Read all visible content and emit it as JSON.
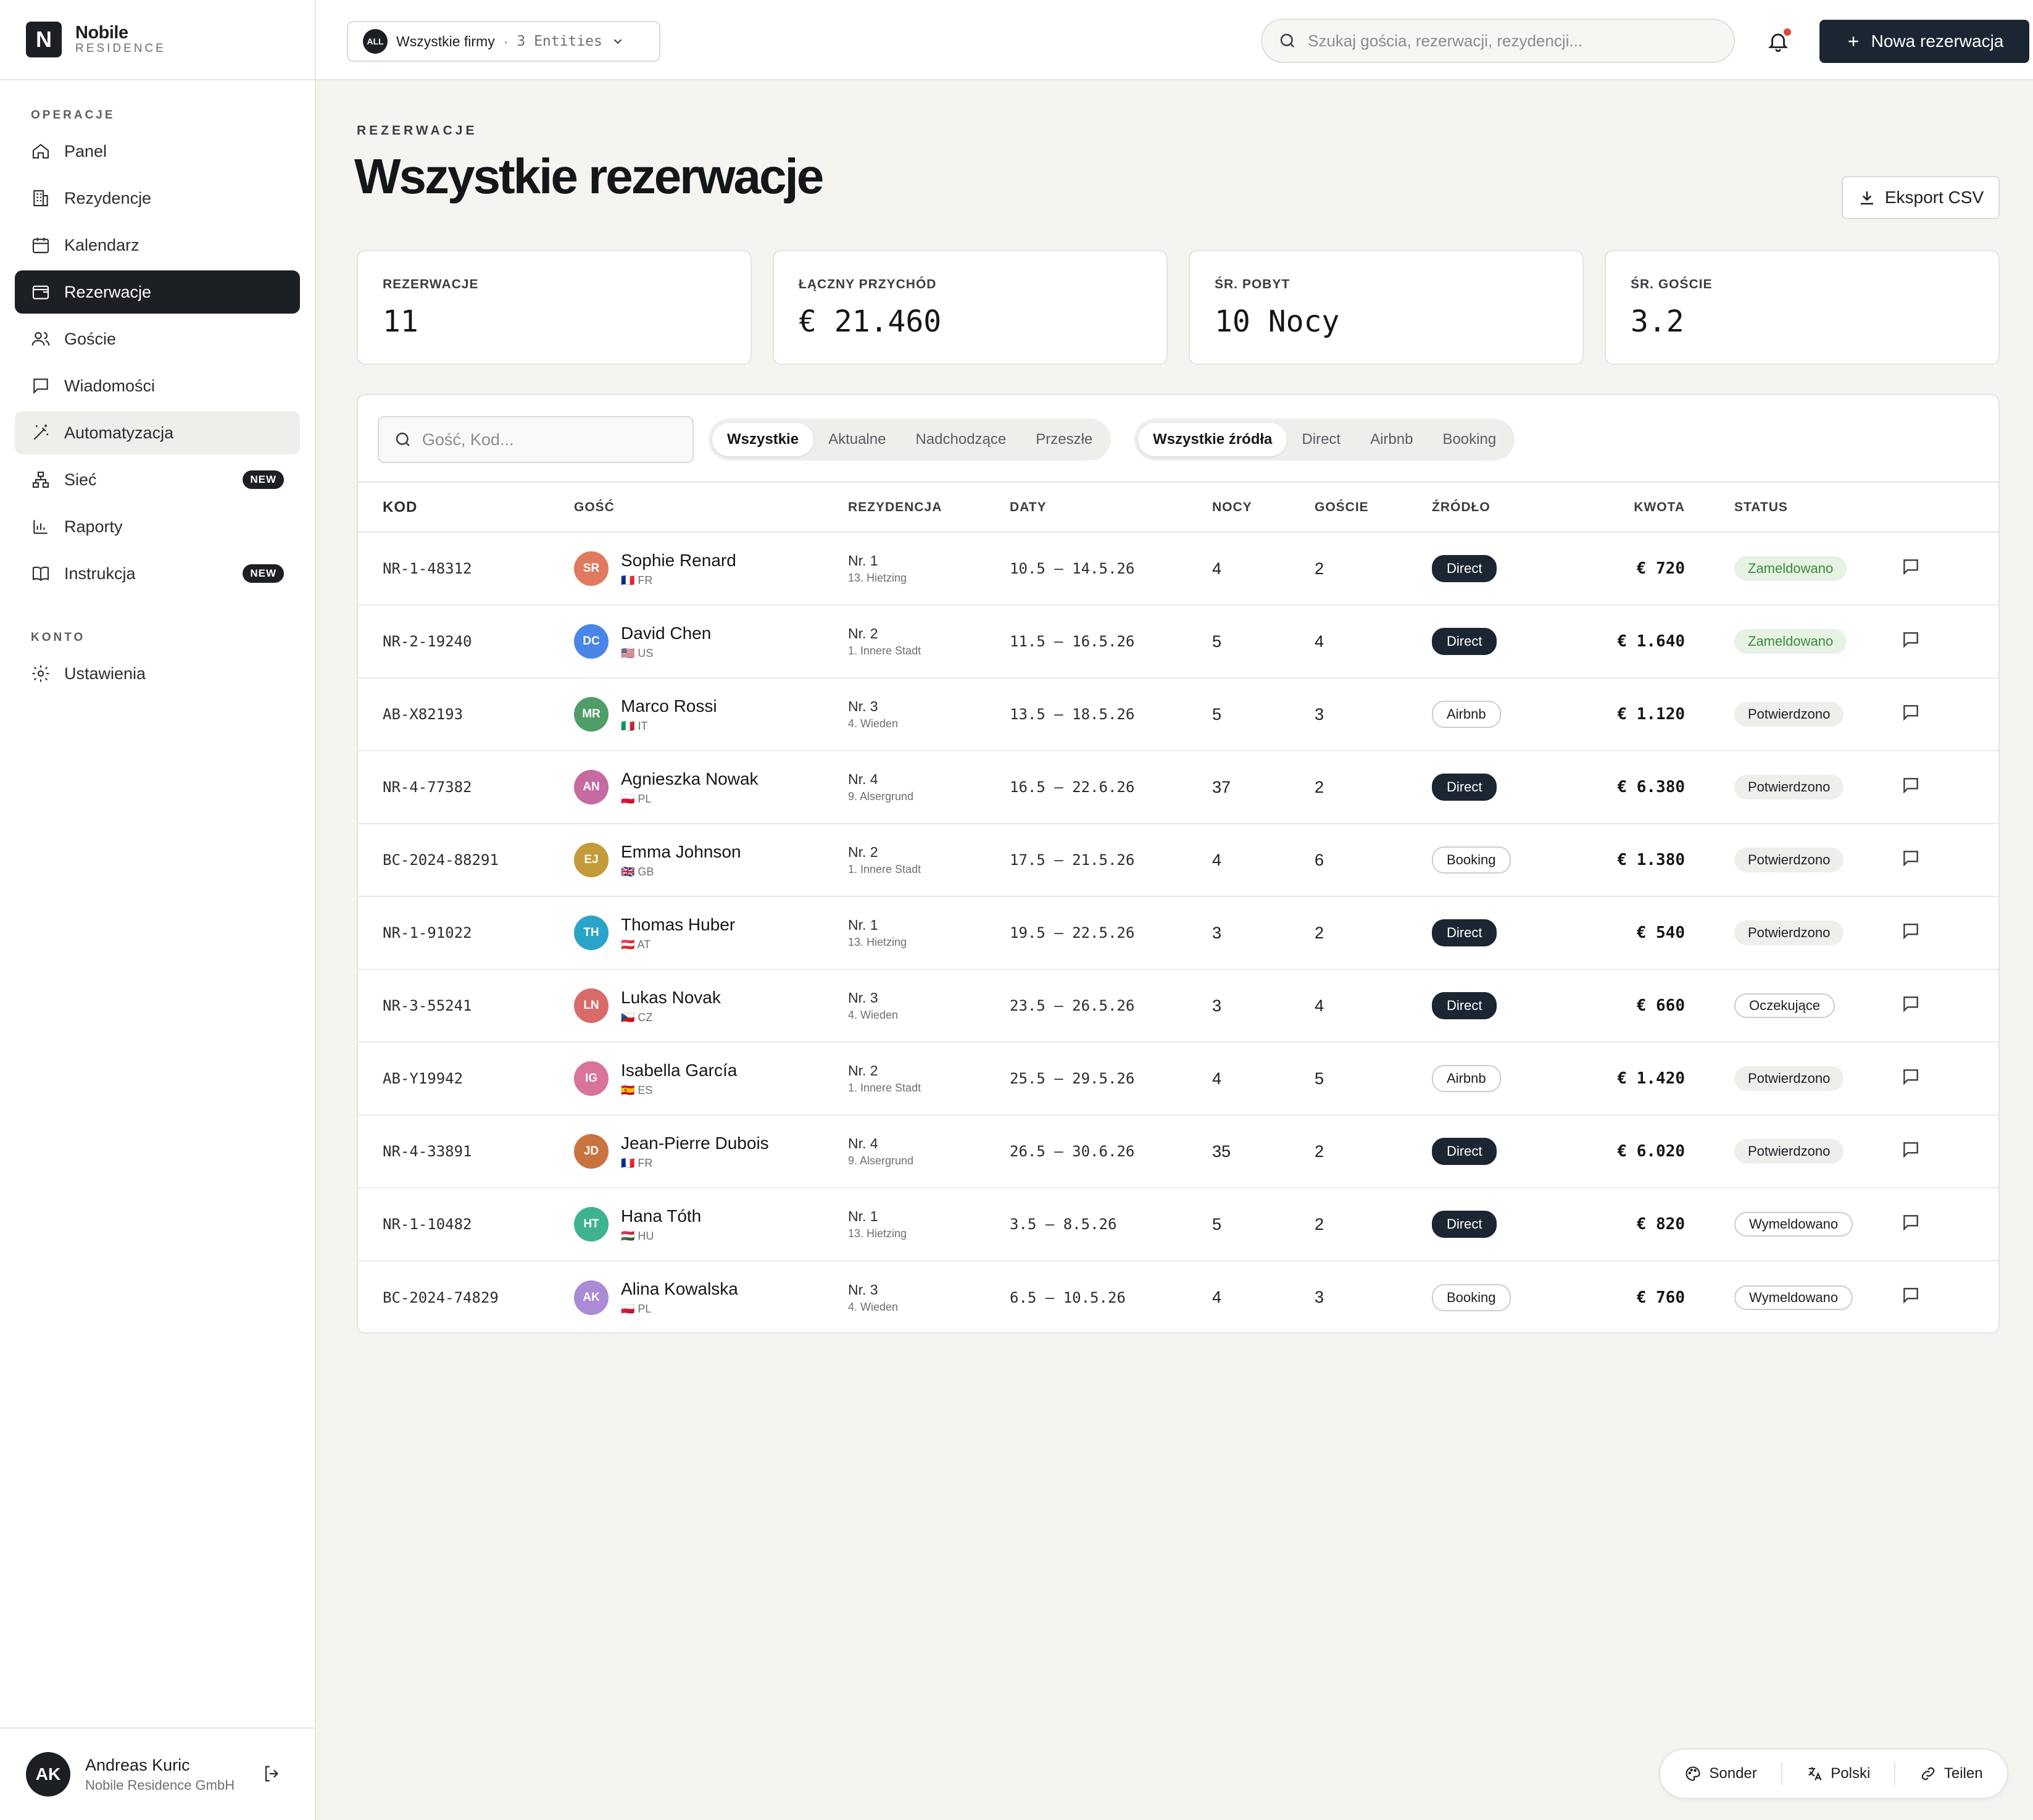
{
  "brand": {
    "logo_letter": "N",
    "name": "Nobile",
    "sub": "RESIDENCE"
  },
  "sidebar": {
    "section_ops": "OPERACJE",
    "items": [
      {
        "label": "Panel",
        "icon": "home-icon"
      },
      {
        "label": "Rezydencje",
        "icon": "building-icon"
      },
      {
        "label": "Kalendarz",
        "icon": "calendar-icon"
      },
      {
        "label": "Rezerwacje",
        "icon": "wallet-icon",
        "active": true
      },
      {
        "label": "Goście",
        "icon": "users-icon"
      },
      {
        "label": "Wiadomości",
        "icon": "message-icon"
      },
      {
        "label": "Automatyzacja",
        "icon": "magic-wand-icon"
      },
      {
        "label": "Sieć",
        "icon": "network-icon",
        "badge": "NEW"
      },
      {
        "label": "Raporty",
        "icon": "bar-chart-icon"
      },
      {
        "label": "Instrukcja",
        "icon": "book-icon",
        "badge": "NEW"
      }
    ],
    "section_account": "KONTO",
    "settings_label": "Ustawienia"
  },
  "user": {
    "initials": "AK",
    "name": "Andreas Kuric",
    "company": "Nobile Residence GmbH"
  },
  "topbar": {
    "entity_badge": "ALL",
    "entity_name": "Wszystkie firmy",
    "entity_sep": "·",
    "entity_count": "3 Entities",
    "search_placeholder": "Szukaj gościa, rezerwacji, rezydencji...",
    "new_button": "Nowa rezerwacja"
  },
  "page": {
    "overline": "REZERWACJE",
    "title": "Wszystkie rezerwacje",
    "export_label": "Eksport CSV"
  },
  "stats": [
    {
      "label": "REZERWACJE",
      "value": "11"
    },
    {
      "label": "ŁĄCZNY PRZYCHÓD",
      "value": "€ 21.460"
    },
    {
      "label": "ŚR. POBYT",
      "value": "10 Nocy"
    },
    {
      "label": "ŚR. GOŚCIE",
      "value": "3.2"
    }
  ],
  "filters": {
    "search_placeholder": "Gość, Kod...",
    "time": [
      "Wszystkie",
      "Aktualne",
      "Nadchodzące",
      "Przeszłe"
    ],
    "source": [
      "Wszystkie źródła",
      "Direct",
      "Airbnb",
      "Booking"
    ]
  },
  "table": {
    "headers": [
      "KOD",
      "GOŚĆ",
      "REZYDENCJA",
      "DATY",
      "NOCY",
      "GOŚCIE",
      "ŹRÓDŁO",
      "KWOTA",
      "STATUS"
    ],
    "rows": [
      {
        "code": "NR-1-48312",
        "initials": "SR",
        "avatar_color": "#e07a5f",
        "guest": "Sophie Renard",
        "country": "🇫🇷 FR",
        "res": "Nr. 1",
        "district": "13. Hietzing",
        "dates": "10.5 – 14.5.26",
        "nights": "4",
        "guests": "2",
        "source": "Direct",
        "amount": "€ 720",
        "status": "Zameldowano"
      },
      {
        "code": "NR-2-19240",
        "initials": "DC",
        "avatar_color": "#4a86e8",
        "guest": "David Chen",
        "country": "🇺🇸 US",
        "res": "Nr. 2",
        "district": "1. Innere Stadt",
        "dates": "11.5 – 16.5.26",
        "nights": "5",
        "guests": "4",
        "source": "Direct",
        "amount": "€ 1.640",
        "status": "Zameldowano"
      },
      {
        "code": "AB-X82193",
        "initials": "MR",
        "avatar_color": "#4f9d69",
        "guest": "Marco Rossi",
        "country": "🇮🇹 IT",
        "res": "Nr. 3",
        "district": "4. Wieden",
        "dates": "13.5 – 18.5.26",
        "nights": "5",
        "guests": "3",
        "source": "Airbnb",
        "amount": "€ 1.120",
        "status": "Potwierdzono"
      },
      {
        "code": "NR-4-77382",
        "initials": "AN",
        "avatar_color": "#c56ba1",
        "guest": "Agnieszka Nowak",
        "country": "🇵🇱 PL",
        "res": "Nr. 4",
        "district": "9. Alsergrund",
        "dates": "16.5 – 22.6.26",
        "nights": "37",
        "guests": "2",
        "source": "Direct",
        "amount": "€ 6.380",
        "status": "Potwierdzono"
      },
      {
        "code": "BC-2024-88291",
        "initials": "EJ",
        "avatar_color": "#c49a3a",
        "guest": "Emma Johnson",
        "country": "🇬🇧 GB",
        "res": "Nr. 2",
        "district": "1. Innere Stadt",
        "dates": "17.5 – 21.5.26",
        "nights": "4",
        "guests": "6",
        "source": "Booking",
        "amount": "€ 1.380",
        "status": "Potwierdzono"
      },
      {
        "code": "NR-1-91022",
        "initials": "TH",
        "avatar_color": "#2aa3c9",
        "guest": "Thomas Huber",
        "country": "🇦🇹 AT",
        "res": "Nr. 1",
        "district": "13. Hietzing",
        "dates": "19.5 – 22.5.26",
        "nights": "3",
        "guests": "2",
        "source": "Direct",
        "amount": "€ 540",
        "status": "Potwierdzono"
      },
      {
        "code": "NR-3-55241",
        "initials": "LN",
        "avatar_color": "#d96a6a",
        "guest": "Lukas Novak",
        "country": "🇨🇿 CZ",
        "res": "Nr. 3",
        "district": "4. Wieden",
        "dates": "23.5 – 26.5.26",
        "nights": "3",
        "guests": "4",
        "source": "Direct",
        "amount": "€ 660",
        "status": "Oczekujące"
      },
      {
        "code": "AB-Y19942",
        "initials": "IG",
        "avatar_color": "#d9739b",
        "guest": "Isabella García",
        "country": "🇪🇸 ES",
        "res": "Nr. 2",
        "district": "1. Innere Stadt",
        "dates": "25.5 – 29.5.26",
        "nights": "4",
        "guests": "5",
        "source": "Airbnb",
        "amount": "€ 1.420",
        "status": "Potwierdzono"
      },
      {
        "code": "NR-4-33891",
        "initials": "JD",
        "avatar_color": "#c9733f",
        "guest": "Jean-Pierre Dubois",
        "country": "🇫🇷 FR",
        "res": "Nr. 4",
        "district": "9. Alsergrund",
        "dates": "26.5 – 30.6.26",
        "nights": "35",
        "guests": "2",
        "source": "Direct",
        "amount": "€ 6.020",
        "status": "Potwierdzono"
      },
      {
        "code": "NR-1-10482",
        "initials": "HT",
        "avatar_color": "#3fb28f",
        "guest": "Hana Tóth",
        "country": "🇭🇺 HU",
        "res": "Nr. 1",
        "district": "13. Hietzing",
        "dates": "3.5 – 8.5.26",
        "nights": "5",
        "guests": "2",
        "source": "Direct",
        "amount": "€ 820",
        "status": "Wymeldowano"
      },
      {
        "code": "BC-2024-74829",
        "initials": "AK",
        "avatar_color": "#a98bd6",
        "guest": "Alina Kowalska",
        "country": "🇵🇱 PL",
        "res": "Nr. 3",
        "district": "4. Wieden",
        "dates": "6.5 – 10.5.26",
        "nights": "4",
        "guests": "3",
        "source": "Booking",
        "amount": "€ 760",
        "status": "Wymeldowano"
      }
    ]
  },
  "footer_pill": {
    "theme": "Sonder",
    "language": "Polski",
    "share": "Teilen"
  }
}
